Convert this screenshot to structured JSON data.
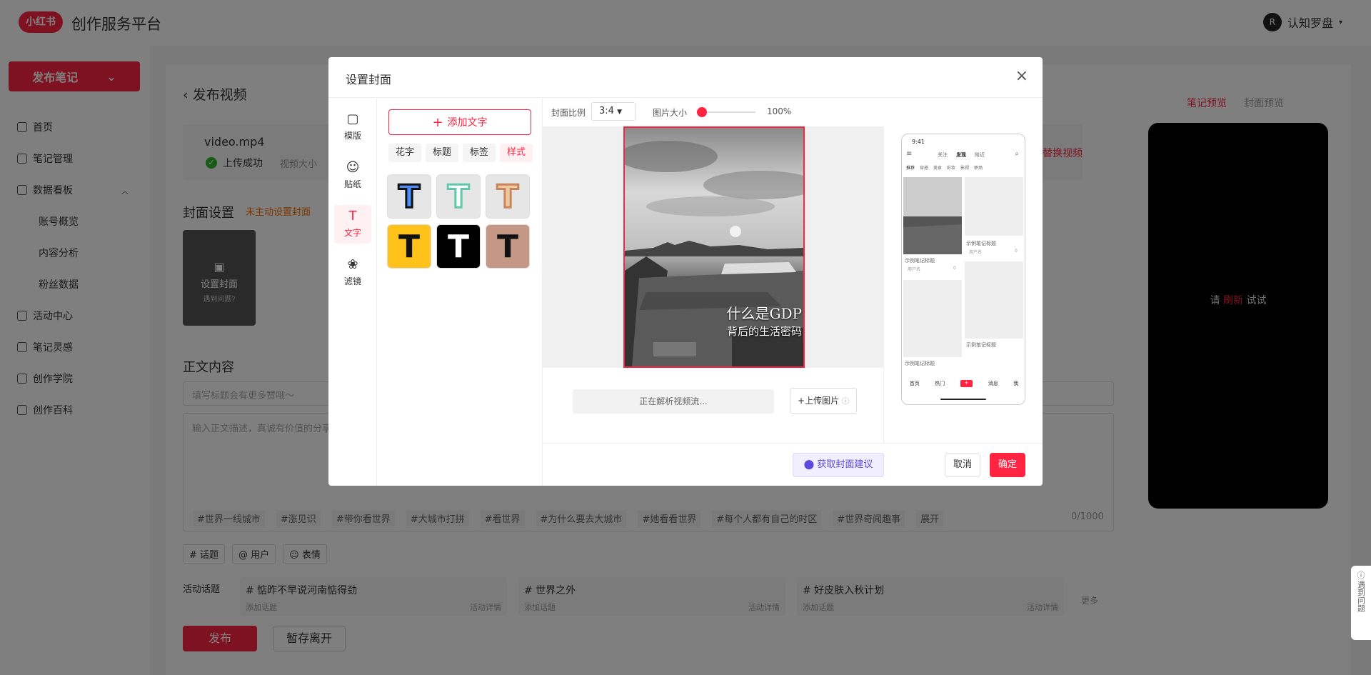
{
  "header": {
    "logo": "小红书",
    "brand": "创作服务平台",
    "user_avatar": "R",
    "user_name": "认知罗盘"
  },
  "sidebar": {
    "publish_button": "发布笔记",
    "items": [
      {
        "label": "首页"
      },
      {
        "label": "笔记管理"
      },
      {
        "label": "数据看板"
      },
      {
        "label": "账号概览"
      },
      {
        "label": "内容分析"
      },
      {
        "label": "粉丝数据"
      },
      {
        "label": "活动中心"
      },
      {
        "label": "笔记灵感"
      },
      {
        "label": "创作学院"
      },
      {
        "label": "创作百科"
      }
    ]
  },
  "main": {
    "back_title": "发布视频",
    "file_name": "video.mp4",
    "upload_status": "上传成功",
    "video_size": "视频大小",
    "replace_video": "替换视频",
    "cover_section": "封面设置",
    "cover_warning": "未主动设置封面",
    "set_cover": "设置封面",
    "cover_help": "遇到问题?",
    "body_section": "正文内容",
    "title_placeholder": "填写标题会有更多赞哦～",
    "desc_placeholder": "输入正文描述，真诚有价值的分享予人温暖",
    "hashtags": [
      "#世界一线城市",
      "#涨见识",
      "#带你看世界",
      "#大城市打拼",
      "#看世界",
      "#为什么要去大城市",
      "#她看看世界",
      "#每个人都有自己的时区",
      "#世界奇闻趣事"
    ],
    "expand": "展开",
    "char_count": "0/1000",
    "insert": [
      "# 话题",
      "@ 用户",
      "☺ 表情"
    ],
    "activity_label": "活动话题",
    "activities": [
      {
        "title": "# 惦昨不早说河南惦得劲",
        "add": "添加话题",
        "detail": "活动详情"
      },
      {
        "title": "# 世界之外",
        "add": "添加话题",
        "detail": "活动详情"
      },
      {
        "title": "# 好皮肤入秋计划",
        "add": "添加话题",
        "detail": "活动详情"
      }
    ],
    "more": "更多",
    "publish": "发布",
    "save_draft": "暂存离开",
    "preview_tabs": [
      "笔记预览",
      "封面预览"
    ],
    "preview_text": {
      "a": "请",
      "b": "刷新",
      "c": "试试"
    }
  },
  "modal": {
    "title": "设置封面",
    "tools": [
      {
        "label": "模版",
        "icon": "template-icon"
      },
      {
        "label": "贴纸",
        "icon": "sticker-icon"
      },
      {
        "label": "文字",
        "icon": "text-icon"
      },
      {
        "label": "滤镜",
        "icon": "filter-icon"
      }
    ],
    "add_text": "添加文字",
    "text_tabs": [
      "花字",
      "标题",
      "标签",
      "样式"
    ],
    "ratio_label": "封面比例",
    "ratio_value": "3:4",
    "size_label": "图片大小",
    "size_value": "100%",
    "size_fraction": 0.0,
    "cover_text": {
      "line1": "什么是GDP",
      "line2": "背后的生活密码"
    },
    "parsing": "正在解析视频流...",
    "upload_image": "上传图片",
    "suggest": "获取封面建议",
    "cancel": "取消",
    "confirm": "确定",
    "mini_preview": {
      "time": "9:41",
      "tabs": [
        "关注",
        "发现",
        "附近"
      ],
      "channels": [
        "推荐",
        "穿搭",
        "美食",
        "彩妆",
        "影视",
        "职场"
      ],
      "card_title": "示例笔记标题",
      "user": "用户名",
      "likes": "0",
      "bottom": [
        "首页",
        "热门",
        "+",
        "消息",
        "我"
      ]
    }
  },
  "help": "遇到问题",
  "colors": {
    "accent": "#ff2442"
  }
}
